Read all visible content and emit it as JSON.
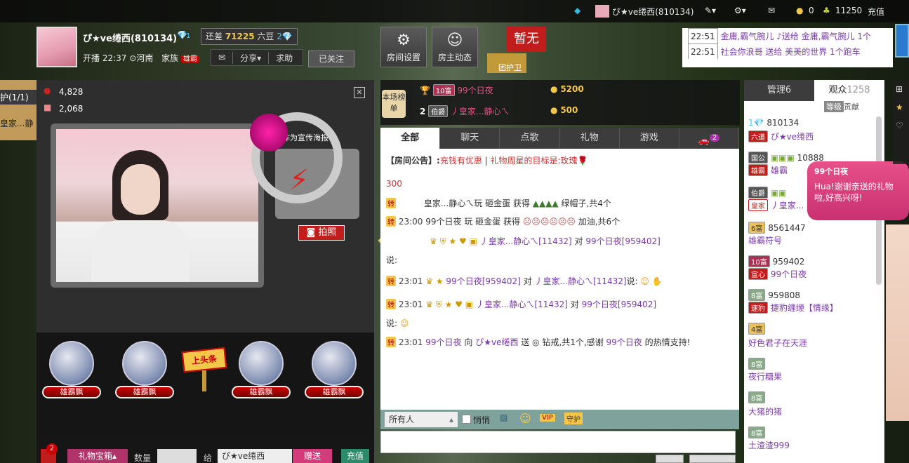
{
  "topbar": {
    "user": "ぴ★ve绻西(810134)",
    "coins": "0",
    "beans": "11250",
    "recharge": "充值"
  },
  "host": {
    "name": "ぴ★ve绻西",
    "id": "(810134)",
    "level": "1",
    "gap_label": "还差",
    "gap_value": "71225",
    "gap_unit": "六豆",
    "gap_level": "2",
    "start_label": "开播",
    "start_time": "22:37",
    "location": "河南",
    "family_label": "家族",
    "family_tag": "雄霸",
    "share": "分享",
    "help": "求助",
    "follow": "已关注"
  },
  "header_buttons": {
    "room_settings": "房间设置",
    "host_feed": "房主动态",
    "guard_status": "暂无",
    "guard_label": "团护卫"
  },
  "stats": {
    "wealth": "4,828",
    "gift": "2,068"
  },
  "left_edge": {
    "guard": "护(1/1)",
    "name": "皇家...静"
  },
  "video": {
    "poster_text": "作为宣传海报",
    "photo": "拍照"
  },
  "gift_orbs": [
    "雄霸飘",
    "雄霸飘",
    "雄霸飘",
    "雄霸飘"
  ],
  "headline": "上头条",
  "bottom": {
    "treasure": "礼物宝箱",
    "qty_label": "数量",
    "to_label": "给",
    "to_value": "ぴ★ve绻西",
    "send": "赠送",
    "recharge": "充值",
    "badge": "2"
  },
  "rank": {
    "title": "本场榜单",
    "rows": [
      {
        "level": "10富",
        "name": "99个日夜",
        "value": "5200"
      },
      {
        "level": "伯爵",
        "name": "丿皇家...静心ㄟ",
        "value": "500"
      }
    ],
    "row_nums": [
      "1",
      "2"
    ]
  },
  "chat": {
    "tabs": [
      "全部",
      "聊天",
      "点歌",
      "礼物",
      "游戏"
    ],
    "car_badge": "2",
    "notice": "【房间公告】:",
    "notice_a": "充钱有优惠",
    "notice_b": "礼物周星的目标是:玫瑰",
    "l0": "300",
    "l1": "皇家...静心ㄟ玩 砸金蛋 获得",
    "l1b": "绿帽子,共4个",
    "l2t": "23:00",
    "l2": "99个日夜 玩 砸金蛋 获得",
    "l2b": "加油,共6个",
    "l3": "丿皇家...静心ㄟ",
    "l3id": "[11432]",
    "l3m": "对",
    "l3n": "99个日夜",
    "l3id2": "[959402]",
    "say": "说:",
    "l4t": "23:01",
    "l4": "99个日夜",
    "l4id": "[959402]",
    "l4m": "对",
    "l4n": "丿皇家...静心ㄟ",
    "l4id2": "[11432]",
    "l5t": "23:01",
    "l5": "丿皇家...静心ㄟ",
    "l5id": "[11432]",
    "l5n": "99个日夜",
    "l5id2": "[959402]",
    "l6t": "23:01",
    "l6a": "99个日夜",
    "l6b": "向",
    "l6c": "ぴ★ve绻西",
    "l6d": "送",
    "l6e": "钻戒,共1个,感谢",
    "l6f": "99个日夜",
    "l6g": "的热情支持!",
    "zh": "转",
    "audience": "所有人",
    "whisper": "悄悄",
    "vip": "VIP",
    "guard": "守护"
  },
  "side": {
    "tab_admin": "管理6",
    "tab_viewers": "观众",
    "viewers": "1258",
    "sort_level": "等级",
    "sort_contrib": "贡献",
    "users": [
      {
        "lv": "1",
        "id": "810134",
        "tag": "六道",
        "name": "ぴ★ve绻西"
      },
      {
        "lv": "国公",
        "id": "10888",
        "tag": "雄霸",
        "name": "雄霸"
      },
      {
        "lv": "伯爵",
        "id": "",
        "tag": "皇家",
        "name": "丿皇家..."
      },
      {
        "lv": "6富",
        "id": "8561447",
        "tag": "",
        "name": "雄霸符号"
      },
      {
        "lv": "10富",
        "id": "959402",
        "tag": "宣心",
        "name": "99个日夜"
      },
      {
        "lv": "8富",
        "id": "959808",
        "tag": "速豹",
        "name": "捷豹缠缏【情缘】"
      },
      {
        "lv": "4富",
        "id": "",
        "tag": "",
        "name": "好色君子在天涯"
      },
      {
        "lv": "8富",
        "id": "",
        "tag": "",
        "name": "夜行糖果"
      },
      {
        "lv": "8富",
        "id": "",
        "tag": "",
        "name": "大猪的猪"
      },
      {
        "lv": "8富",
        "id": "",
        "tag": "",
        "name": "土渣渣999"
      }
    ]
  },
  "ticker": [
    {
      "time": "22:51",
      "text": "金庸,霸气腕儿 ♪送给 金庸,霸气腕儿 1个"
    },
    {
      "time": "22:51",
      "text": "社会你浪哥 送给 美美的世界 1个跑车"
    }
  ],
  "bubble": {
    "title": "99个日夜",
    "text": "Hua!谢谢亲送的礼物啦,好高兴呀!"
  }
}
